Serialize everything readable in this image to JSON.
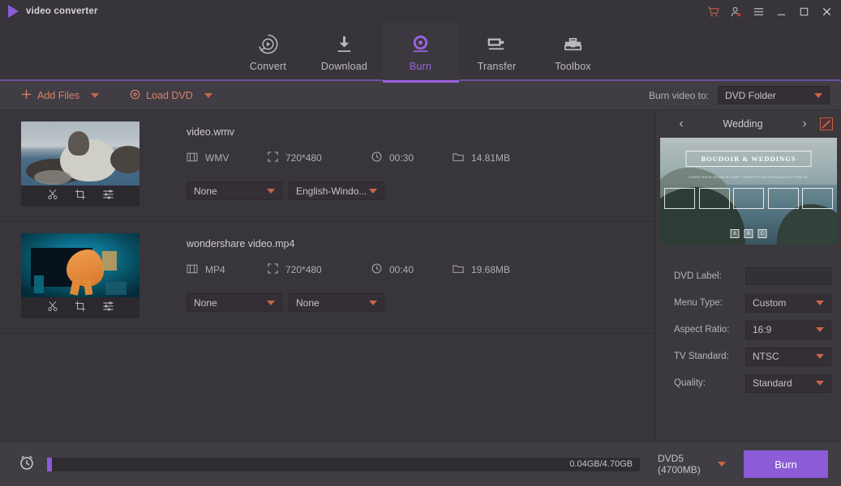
{
  "app": {
    "title": "video converter",
    "logo_icon": "play-triangle-icon"
  },
  "titlebar": {
    "cart_icon": "shopping-cart-icon",
    "account_icon": "user-account-icon",
    "menu_icon": "hamburger-menu-icon",
    "minimize_icon": "minimize-icon",
    "maximize_icon": "maximize-icon",
    "close_icon": "close-icon"
  },
  "nav": {
    "items": [
      {
        "label": "Convert",
        "icon": "convert-circular-play-icon",
        "active": false
      },
      {
        "label": "Download",
        "icon": "download-arrow-icon",
        "active": false
      },
      {
        "label": "Burn",
        "icon": "burn-disc-icon",
        "active": true
      },
      {
        "label": "Transfer",
        "icon": "transfer-device-icon",
        "active": false
      },
      {
        "label": "Toolbox",
        "icon": "toolbox-icon",
        "active": false
      }
    ],
    "active_color": "#9a63e0"
  },
  "toolbar": {
    "add_files_label": "Add Files",
    "add_files_icon": "plus-icon",
    "load_dvd_label": "Load DVD",
    "load_dvd_icon": "disc-circle-icon",
    "burn_video_to_label": "Burn video to:",
    "burn_target_value": "DVD Folder",
    "accent_color": "#d9826a"
  },
  "files": [
    {
      "name": "video.wmv",
      "format": "WMV",
      "resolution": "720*480",
      "duration": "00:30",
      "size": "14.81MB",
      "subtitle_value": "None",
      "audio_value": "English-Windo...",
      "thumbnail": "seals-on-ice",
      "tools": [
        "trim-scissors-icon",
        "crop-icon",
        "effects-sliders-icon"
      ]
    },
    {
      "name": "wondershare video.mp4",
      "format": "MP4",
      "resolution": "720*480",
      "duration": "00:40",
      "size": "19.68MB",
      "subtitle_value": "None",
      "audio_value": "None",
      "thumbnail": "tv-orange-hand",
      "tools": [
        "trim-scissors-icon",
        "crop-icon",
        "effects-sliders-icon"
      ]
    }
  ],
  "panel": {
    "prev_icon": "chevron-left-icon",
    "next_icon": "chevron-right-icon",
    "template_name": "Wedding",
    "edit_icon": "edit-pencil-icon",
    "preview": {
      "title": "BOUDOIR & WEDDINGS",
      "subtitle": "LOREM IPSUM DOLOR SIT AMET CONSECTETUR ADIPISCING ELIT SED DO",
      "frame_count": 5,
      "buttons": [
        "A",
        "B",
        "C"
      ]
    },
    "settings": [
      {
        "label": "DVD Label:",
        "value": "",
        "type": "input"
      },
      {
        "label": "Menu Type:",
        "value": "Custom",
        "type": "select"
      },
      {
        "label": "Aspect Ratio:",
        "value": "16:9",
        "type": "select"
      },
      {
        "label": "TV Standard:",
        "value": "NTSC",
        "type": "select"
      },
      {
        "label": "Quality:",
        "value": "Standard",
        "type": "select"
      }
    ]
  },
  "bottom": {
    "clock_icon": "alarm-clock-icon",
    "progress_text": "0.04GB/4.70GB",
    "progress_percent": 1,
    "disc_type": "DVD5 (4700MB)",
    "burn_label": "Burn",
    "burn_color": "#8b5cd6"
  }
}
